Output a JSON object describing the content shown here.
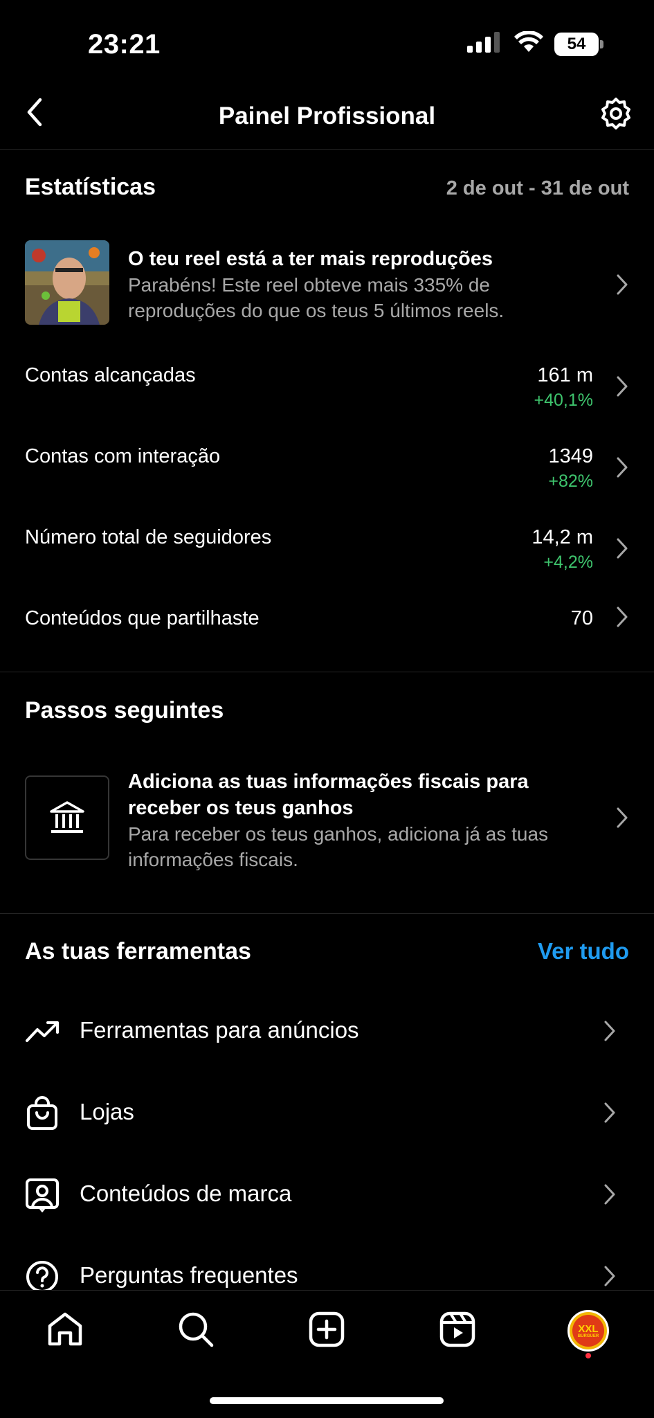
{
  "status_bar": {
    "time": "23:21",
    "battery": "54"
  },
  "header": {
    "title": "Painel Profissional"
  },
  "statistics": {
    "title": "Estatísticas",
    "date_range": "2 de out - 31 de out",
    "reel_card": {
      "title": "O teu reel está a ter mais reproduções",
      "description": "Parabéns! Este reel obteve mais 335% de reproduções do que os teus 5 últimos reels."
    },
    "rows": [
      {
        "label": "Contas alcançadas",
        "value": "161 m",
        "change": "+40,1%"
      },
      {
        "label": "Contas com interação",
        "value": "1349",
        "change": "+82%"
      },
      {
        "label": "Número total de seguidores",
        "value": "14,2 m",
        "change": "+4,2%"
      },
      {
        "label": "Conteúdos que partilhaste",
        "value": "70",
        "change": ""
      }
    ]
  },
  "next_steps": {
    "title": "Passos seguintes",
    "card": {
      "title": "Adiciona as tuas informações fiscais para receber os teus ganhos",
      "description": "Para receber os teus ganhos, adiciona já as tuas informações fiscais."
    }
  },
  "tools": {
    "title": "As tuas ferramentas",
    "see_all": "Ver tudo",
    "items": [
      {
        "label": "Ferramentas para anúncios",
        "icon": "trending-up-icon"
      },
      {
        "label": "Lojas",
        "icon": "shopping-bag-icon"
      },
      {
        "label": "Conteúdos de marca",
        "icon": "branded-content-icon"
      },
      {
        "label": "Perguntas frequentes",
        "icon": "question-icon"
      }
    ]
  },
  "tab_bar": {
    "tabs": [
      "home-icon",
      "search-icon",
      "create-icon",
      "reels-icon",
      "profile-avatar"
    ],
    "avatar_text": [
      "XXL",
      "BURGUER"
    ]
  },
  "colors": {
    "background": "#000000",
    "accent": "#1f9bf0",
    "positive": "#3ec46d",
    "secondary_text": "#a8a8a8"
  }
}
